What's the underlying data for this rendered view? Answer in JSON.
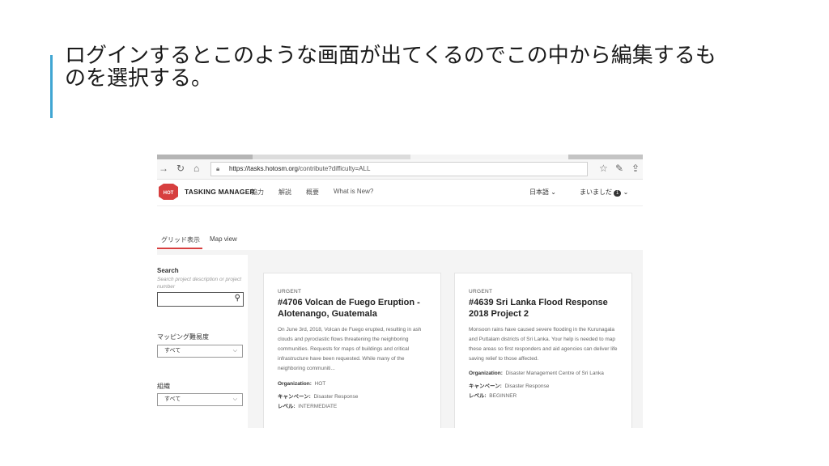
{
  "slide": {
    "title": "ログインするとこのような画面が出てくるのでこの中から編集するものを選択する。"
  },
  "browser": {
    "url_host": "https://tasks.hotosm.org",
    "url_path": "/contribute?difficulty=ALL",
    "icons": [
      "forward-icon",
      "refresh-icon",
      "home-icon",
      "lock-icon",
      "favorite-star-icon",
      "pen-icon",
      "share-icon"
    ]
  },
  "app": {
    "brand": "TASKING MANAGER",
    "logo_text": "HOT",
    "menu": [
      "協力",
      "解説",
      "概要",
      "What is New?"
    ],
    "language": "日本語",
    "user": "まいましだ",
    "user_badge": "1",
    "view_tabs": [
      "グリッド表示",
      "Map view"
    ]
  },
  "filters": {
    "search_label": "Search",
    "search_placeholder": "Search project description or project number",
    "difficulty_label": "マッピング難易度",
    "difficulty_value": "すべて",
    "org_label": "組織",
    "org_value": "すべて"
  },
  "projects": [
    {
      "priority": "URGENT",
      "title": "#4706 Volcan de Fuego Eruption - Alotenango, Guatemala",
      "description": "On June 3rd, 2018, Volcan de Fuego erupted, resulting in ash clouds and pyroclastic flows threatening the neighboring communities. Requests for maps of buildings and critical infrastructure have been requested. While many of the neighboring communiti...",
      "org_label": "Organization:",
      "org": "HOT",
      "campaign_label": "キャンペーン:",
      "campaign": "Disaster Response",
      "level_label": "レベル:",
      "level": "INTERMEDIATE"
    },
    {
      "priority": "URGENT",
      "title": "#4639 Sri Lanka Flood Response 2018 Project 2",
      "description": "Monsoon rains have caused severe flooding in the Kurunagala and Puttalam districts of Sri Lanka. Your help is needed to map these areas so first responders and aid agencies can deliver life saving relief to those affected.",
      "org_label": "Organization:",
      "org": "Disaster Management Centre of Sri Lanka",
      "campaign_label": "キャンペーン:",
      "campaign": "Disaster Response",
      "level_label": "レベル:",
      "level": "BEGINNER"
    }
  ],
  "colors": {
    "accent_bar": "#41a6d3",
    "hot_red": "#d73f3f"
  }
}
